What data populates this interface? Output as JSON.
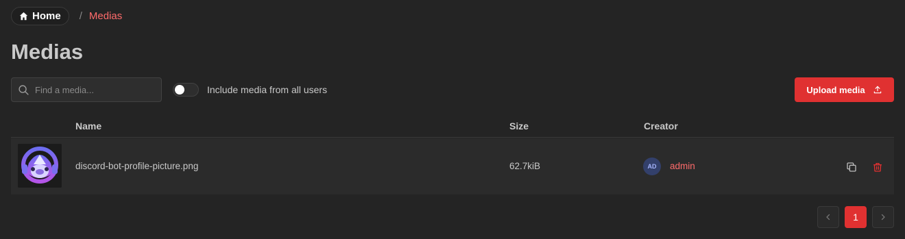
{
  "breadcrumb": {
    "home_label": "Home",
    "separator": "/",
    "current": "Medias"
  },
  "page": {
    "title": "Medias"
  },
  "toolbar": {
    "search_placeholder": "Find a media...",
    "search_value": "",
    "toggle_label": "Include media from all users",
    "toggle_on": false,
    "upload_label": "Upload media"
  },
  "table": {
    "columns": [
      "Name",
      "Size",
      "Creator"
    ],
    "rows": [
      {
        "name": "discord-bot-profile-picture.png",
        "size": "62.7kiB",
        "creator_initials": "AD",
        "creator": "admin"
      }
    ]
  },
  "pagination": {
    "current_page": "1"
  },
  "colors": {
    "accent": "#e03131",
    "accent_text": "#ff6b6b",
    "background": "#242424"
  },
  "icons": [
    "home-icon",
    "search-icon",
    "upload-icon",
    "copy-icon",
    "trash-icon",
    "chevron-left-icon",
    "chevron-right-icon"
  ]
}
